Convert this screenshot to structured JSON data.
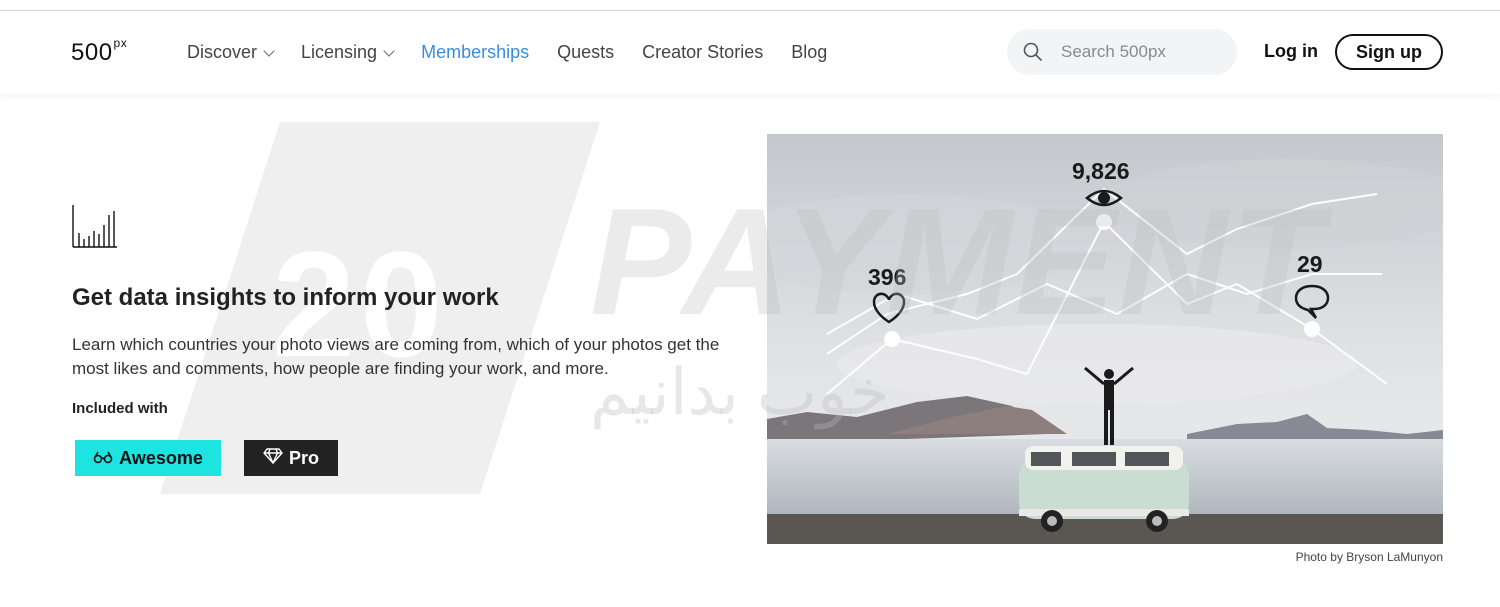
{
  "brand": {
    "logo_main": "500",
    "logo_sup": "px"
  },
  "nav": {
    "items": [
      {
        "label": "Discover",
        "dropdown": true,
        "active": false
      },
      {
        "label": "Licensing",
        "dropdown": true,
        "active": false
      },
      {
        "label": "Memberships",
        "dropdown": false,
        "active": true
      },
      {
        "label": "Quests",
        "dropdown": false,
        "active": false
      },
      {
        "label": "Creator Stories",
        "dropdown": false,
        "active": false
      },
      {
        "label": "Blog",
        "dropdown": false,
        "active": false
      }
    ],
    "search_placeholder": "Search 500px",
    "login_label": "Log in",
    "signup_label": "Sign up"
  },
  "section": {
    "icon": "bar-chart-icon",
    "title": "Get data insights to inform your work",
    "description": "Learn which countries your photo views are coming from, which of your photos get the most likes and comments, how people are finding your work, and more.",
    "included_label": "Included with",
    "badges": [
      {
        "label": "Awesome",
        "icon": "glasses-icon",
        "color": "#1de4e0"
      },
      {
        "label": "Pro",
        "icon": "diamond-icon",
        "color": "#222222"
      }
    ]
  },
  "photo": {
    "stats": [
      {
        "value": "9,826",
        "icon": "eye-icon"
      },
      {
        "value": "396",
        "icon": "heart-icon"
      },
      {
        "value": "29",
        "icon": "comment-icon"
      }
    ],
    "credit": "Photo by Bryson LaMunyon"
  },
  "watermark": {
    "number": "20",
    "word": "PAYMENT",
    "script": "خوب بدانیم"
  },
  "colors": {
    "accent": "#3b8be0",
    "awesome": "#1de4e0",
    "pro": "#222222"
  }
}
